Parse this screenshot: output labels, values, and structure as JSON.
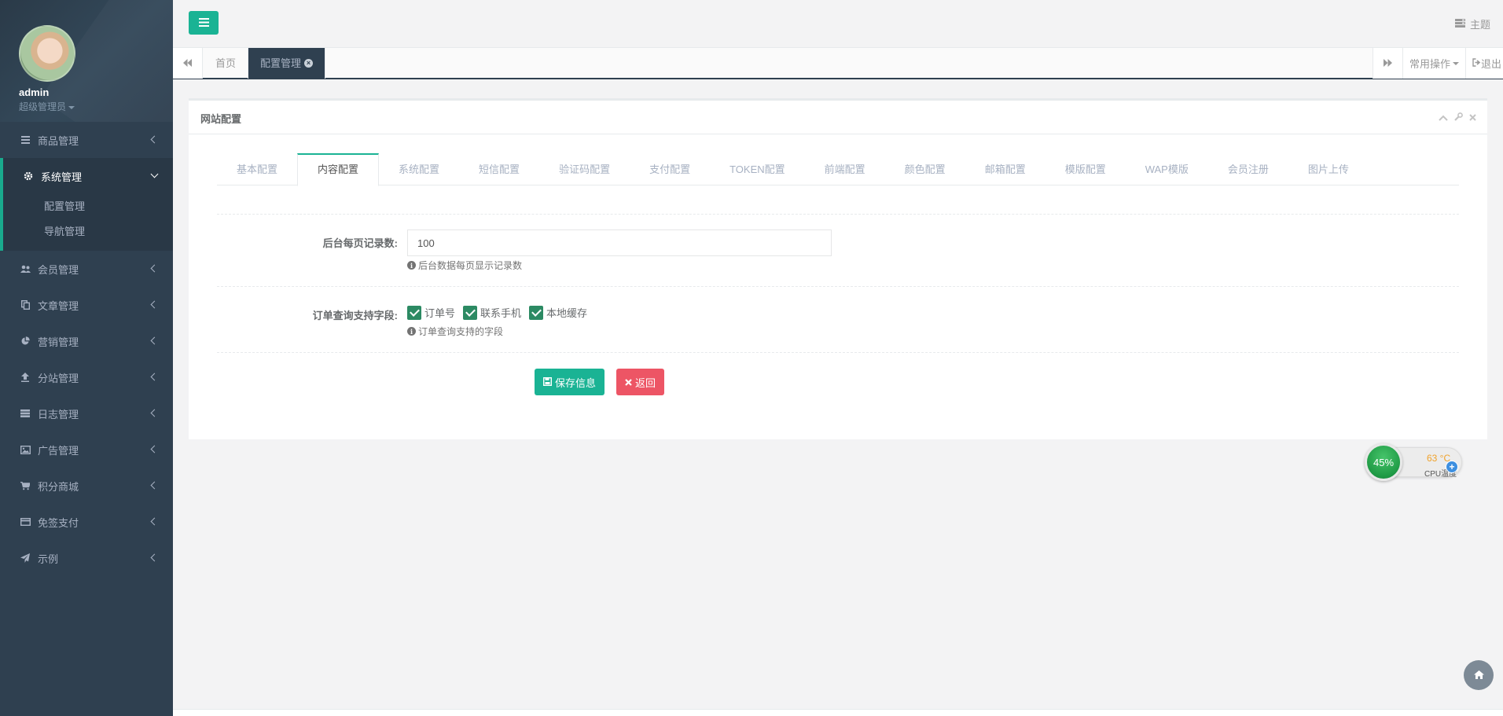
{
  "sidebar": {
    "profile": {
      "name": "admin",
      "role": "超级管理员"
    },
    "menu": [
      {
        "label": "商品管理",
        "icon": "list-icon"
      },
      {
        "label": "系统管理",
        "icon": "gear-icon",
        "active": true,
        "children": [
          "配置管理",
          "导航管理"
        ]
      },
      {
        "label": "会员管理",
        "icon": "users-icon"
      },
      {
        "label": "文章管理",
        "icon": "copy-icon"
      },
      {
        "label": "营销管理",
        "icon": "pie-chart-icon"
      },
      {
        "label": "分站管理",
        "icon": "upload-icon"
      },
      {
        "label": "日志管理",
        "icon": "server-icon"
      },
      {
        "label": "广告管理",
        "icon": "image-icon"
      },
      {
        "label": "积分商城",
        "icon": "cart-icon"
      },
      {
        "label": "免签支付",
        "icon": "credit-card-icon"
      },
      {
        "label": "示例",
        "icon": "send-icon"
      }
    ]
  },
  "topbar": {
    "theme_label": "主题"
  },
  "tabsbar": {
    "tabs": [
      {
        "label": "首页"
      },
      {
        "label": "配置管理",
        "active": true
      }
    ],
    "common_ops_label": "常用操作",
    "logout_label": "退出"
  },
  "panel": {
    "title": "网站配置",
    "tabs": [
      "基本配置",
      "内容配置",
      "系统配置",
      "短信配置",
      "验证码配置",
      "支付配置",
      "TOKEN配置",
      "前端配置",
      "颜色配置",
      "邮箱配置",
      "模版配置",
      "WAP模版",
      "会员注册",
      "图片上传"
    ],
    "active_tab": 1,
    "fields": {
      "page_size": {
        "label": "后台每页记录数:",
        "value": "100",
        "help": "后台数据每页显示记录数"
      },
      "order_query": {
        "label": "订单查询支持字段:",
        "options": [
          {
            "label": "订单号",
            "checked": true
          },
          {
            "label": "联系手机",
            "checked": true
          },
          {
            "label": "本地缓存",
            "checked": true
          }
        ],
        "help": "订单查询支持的字段"
      }
    },
    "save_label": "保存信息",
    "back_label": "返回"
  },
  "cpu_widget": {
    "percent": "45%",
    "temp": "63 °C",
    "label": "CPU温度"
  },
  "colors": {
    "sidebar": "#2f4050",
    "primary": "#1ab394",
    "danger": "#ed5565",
    "checkbox": "#2c8a63"
  }
}
